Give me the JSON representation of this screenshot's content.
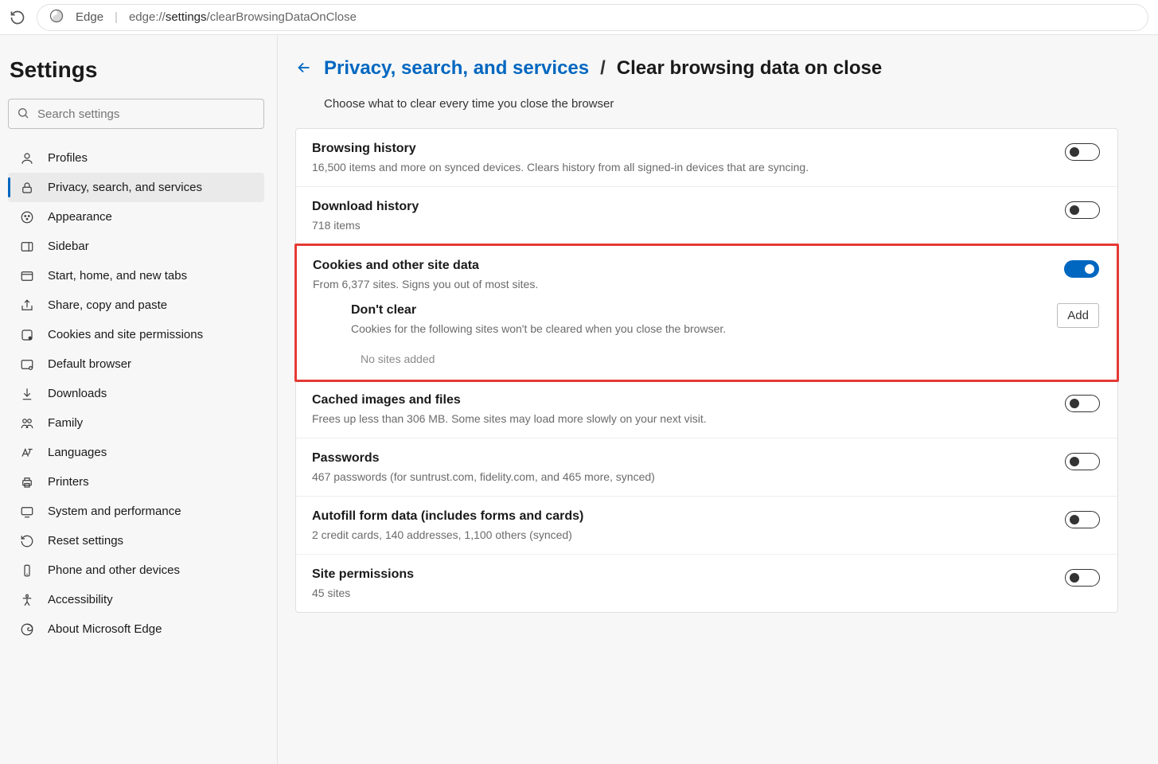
{
  "address": {
    "app": "Edge",
    "url_prefix": "edge://",
    "url_bold": "settings",
    "url_rest": "/clearBrowsingDataOnClose"
  },
  "sidebar": {
    "title": "Settings",
    "search_placeholder": "Search settings",
    "items": [
      {
        "label": "Profiles"
      },
      {
        "label": "Privacy, search, and services"
      },
      {
        "label": "Appearance"
      },
      {
        "label": "Sidebar"
      },
      {
        "label": "Start, home, and new tabs"
      },
      {
        "label": "Share, copy and paste"
      },
      {
        "label": "Cookies and site permissions"
      },
      {
        "label": "Default browser"
      },
      {
        "label": "Downloads"
      },
      {
        "label": "Family"
      },
      {
        "label": "Languages"
      },
      {
        "label": "Printers"
      },
      {
        "label": "System and performance"
      },
      {
        "label": "Reset settings"
      },
      {
        "label": "Phone and other devices"
      },
      {
        "label": "Accessibility"
      },
      {
        "label": "About Microsoft Edge"
      }
    ]
  },
  "header": {
    "parent": "Privacy, search, and services",
    "current": "Clear browsing data on close",
    "desc": "Choose what to clear every time you close the browser"
  },
  "rows": {
    "browsing": {
      "title": "Browsing history",
      "sub": "16,500 items and more on synced devices. Clears history from all signed-in devices that are syncing."
    },
    "download": {
      "title": "Download history",
      "sub": "718 items"
    },
    "cookies": {
      "title": "Cookies and other site data",
      "sub": "From 6,377 sites. Signs you out of most sites."
    },
    "dontclear": {
      "title": "Don't clear",
      "sub": "Cookies for the following sites won't be cleared when you close the browser.",
      "empty": "No sites added",
      "add": "Add"
    },
    "cache": {
      "title": "Cached images and files",
      "sub": "Frees up less than 306 MB. Some sites may load more slowly on your next visit."
    },
    "passwords": {
      "title": "Passwords",
      "sub": "467 passwords (for suntrust.com, fidelity.com, and 465 more, synced)"
    },
    "autofill": {
      "title": "Autofill form data (includes forms and cards)",
      "sub": "2 credit cards, 140 addresses, 1,100 others (synced)"
    },
    "siteperm": {
      "title": "Site permissions",
      "sub": "45 sites"
    }
  }
}
